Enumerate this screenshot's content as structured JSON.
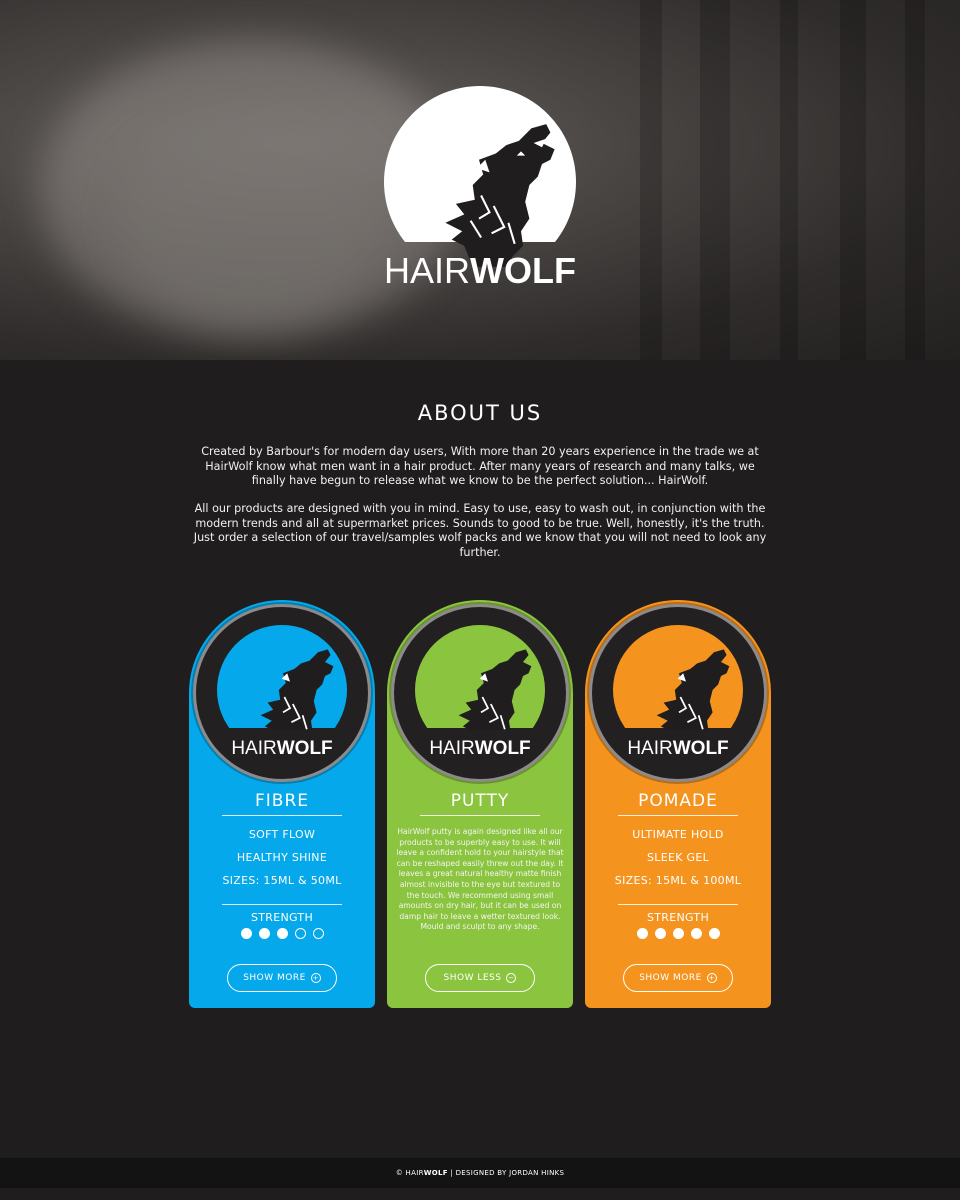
{
  "brand": {
    "name_light": "HAIR",
    "name_bold": "WOLF"
  },
  "about": {
    "title": "ABOUT US",
    "p1": "Created by Barbour's for modern day users, With more than 20 years experience in the trade we at HairWolf know what men want in a hair product. After many years of research and many talks, we finally have begun to release what we know to be the perfect solution... HairWolf.",
    "p2": "All our products are designed with you in mind. Easy to use, easy to wash out, in conjunction with the modern trends and all at supermarket prices. Sounds to good to be true. Well, honestly, it's the truth. Just order a selection of our travel/samples wolf packs and we know that you will not need to look any further."
  },
  "colors": {
    "blue": "#05a8ea",
    "green": "#8bc43f",
    "orange": "#f5931f",
    "background": "#1f1d1e"
  },
  "products": [
    {
      "name": "FIBRE",
      "color": "#05a8ea",
      "features": [
        "SOFT FLOW",
        "HEALTHY SHINE",
        "SIZES: 15ML & 50ML"
      ],
      "strength_label": "STRENGTH",
      "strength": 3,
      "strength_max": 5,
      "button": "SHOW MORE",
      "button_icon": "plus-circle-icon"
    },
    {
      "name": "PUTTY",
      "color": "#8bc43f",
      "description": "HairWolf putty is again designed like all our products to be superbly easy to use. It will leave a confident hold to your hairstyle that can be reshaped easily threw out the day. It leaves a great natural healthy matte finish almost invisible to the eye but textured to the touch. We recommend using small amounts on dry hair, but it can be used on damp hair to leave a wetter textured look. Mould and sculpt to any shape.",
      "button": "SHOW LESS",
      "button_icon": "minus-circle-icon"
    },
    {
      "name": "POMADE",
      "color": "#f5931f",
      "features": [
        "ULTIMATE HOLD",
        "SLEEK GEL",
        "SIZES: 15ML & 100ML"
      ],
      "strength_label": "STRENGTH",
      "strength": 5,
      "strength_max": 5,
      "button": "SHOW MORE",
      "button_icon": "plus-circle-icon"
    }
  ],
  "footer": {
    "copyright": "©",
    "name_light": "HAIR",
    "name_bold": "WOLF",
    "credit": "| DESIGNED BY JORDAN HINKS"
  }
}
